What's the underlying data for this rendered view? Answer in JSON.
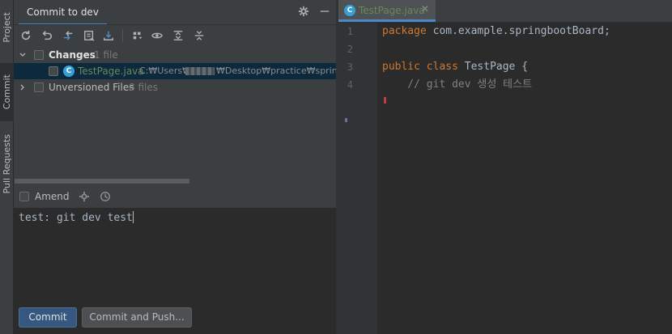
{
  "strip": {
    "tabs": [
      {
        "label": "Project",
        "icon": "folder-icon"
      },
      {
        "label": "Commit",
        "icon": "commit-icon"
      },
      {
        "label": "Pull Requests",
        "icon": "pull-request-icon"
      }
    ]
  },
  "commit_panel": {
    "title": "Commit to dev",
    "changes": {
      "label": "Changes",
      "count": "1 file"
    },
    "file": {
      "name": "TestPage.java",
      "path": "C:₩Users₩",
      "path_rest": "₩Desktop₩practice₩springb"
    },
    "unversioned": {
      "label": "Unversioned Files",
      "count": "8 files"
    },
    "amend_label": "Amend",
    "message": "test: git dev test",
    "commit_button": "Commit",
    "commit_push_button": "Commit and Push..."
  },
  "editor": {
    "tab_label": "TestPage.java",
    "line_numbers": [
      "1",
      "2",
      "3",
      "4"
    ],
    "line1_keyword": "package",
    "line1_rest": " com.example.springbootBoard;",
    "line3_kw1": "public",
    "line3_kw2": " class",
    "line3_rest": " TestPage {",
    "line4_comment": "    // git dev 생성 테스트"
  },
  "colors": {
    "accent": "#4a88c7",
    "file_modified": "#6a8759",
    "keyword": "#cc7832",
    "commit_button": "#365880"
  }
}
